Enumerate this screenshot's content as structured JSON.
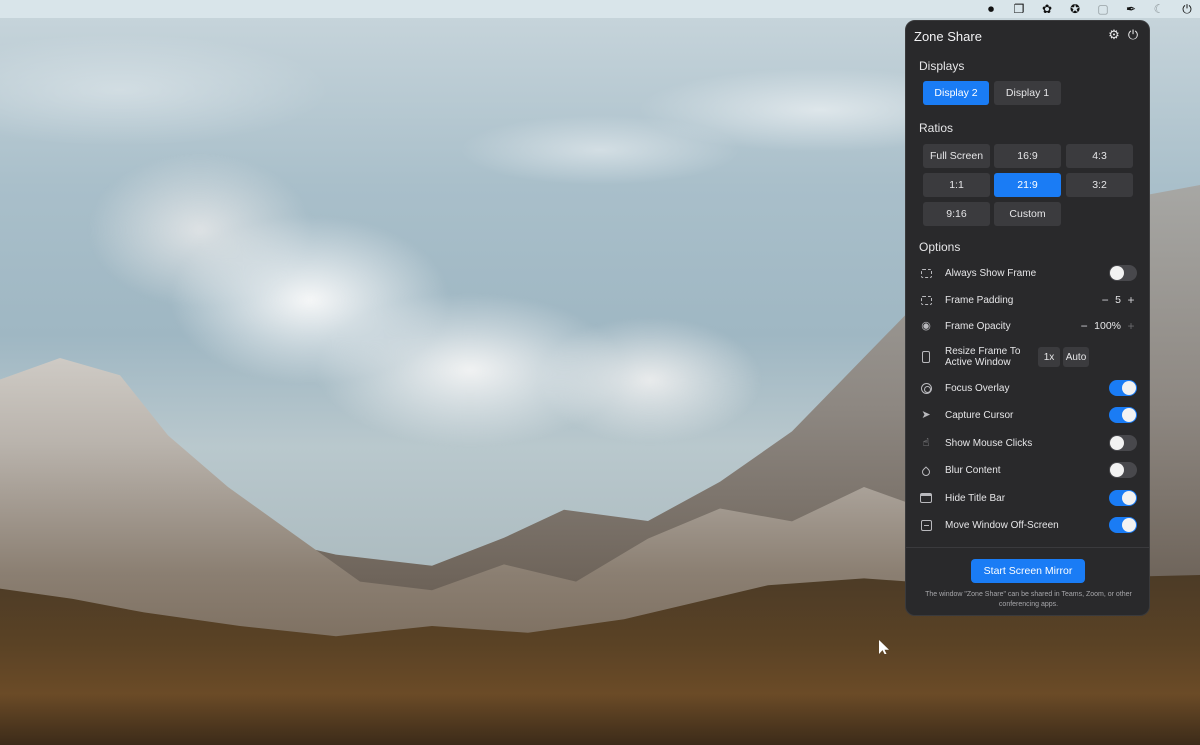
{
  "menubar": {
    "icons": [
      "record-icon",
      "screens-icon",
      "app-icon",
      "aperture-icon",
      "window-icon",
      "pen-icon",
      "moon-icon",
      "power-icon"
    ],
    "glyphs": [
      "⏺",
      "❐",
      "✿",
      "✪",
      "▢",
      "✒",
      "☾",
      "⏻"
    ]
  },
  "panel": {
    "title": "Zone Share",
    "settings_glyph": "⚙",
    "power_glyph": "⏻",
    "displays": {
      "label": "Displays",
      "items": [
        "Display 2",
        "Display 1"
      ],
      "selected": "Display 2"
    },
    "ratios": {
      "label": "Ratios",
      "items": [
        "Full Screen",
        "16:9",
        "4:3",
        "1:1",
        "21:9",
        "3:2",
        "9:16",
        "Custom"
      ],
      "selected": "21:9"
    },
    "options": {
      "label": "Options",
      "always_show_frame": {
        "label": "Always Show Frame",
        "on": false
      },
      "frame_padding": {
        "label": "Frame Padding",
        "value": "5",
        "minus": "−",
        "plus": "+"
      },
      "frame_opacity": {
        "label": "Frame Opacity",
        "value": "100%",
        "minus": "−",
        "plus": "+",
        "eye_glyph": "◉"
      },
      "resize_frame": {
        "label": "Resize Frame To Active Window",
        "btn_1x": "1x",
        "btn_auto": "Auto"
      },
      "focus_overlay": {
        "label": "Focus Overlay",
        "on": true
      },
      "capture_cursor": {
        "label": "Capture Cursor",
        "on": true,
        "glyph": "➤"
      },
      "show_mouse_clicks": {
        "label": "Show Mouse Clicks",
        "on": false,
        "glyph": "☝"
      },
      "blur_content": {
        "label": "Blur Content",
        "on": false
      },
      "hide_title_bar": {
        "label": "Hide Title Bar",
        "on": true
      },
      "move_window_off_screen": {
        "label": "Move Window Off-Screen",
        "on": true
      }
    },
    "start_button": "Start Screen Mirror",
    "footnote": "The window \"Zone Share\" can be shared in Teams, Zoom, or other conferencing apps."
  },
  "colors": {
    "accent": "#1a7cf5",
    "panel_bg": "#29292b",
    "button_bg": "#3b3b3e"
  }
}
